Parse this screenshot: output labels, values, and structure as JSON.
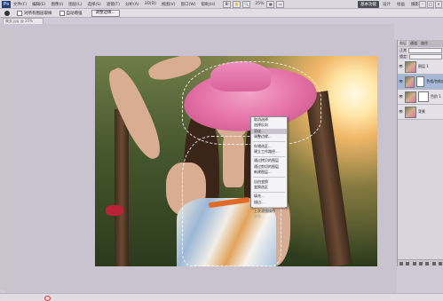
{
  "app": {
    "logo": "Ps",
    "menu": [
      "文件(F)",
      "编辑(E)",
      "图像(I)",
      "图层(L)",
      "选择(S)",
      "滤镜(T)",
      "分析(A)",
      "3D(D)",
      "视图(V)",
      "窗口(W)",
      "帮助(H)"
    ],
    "zoom": "25%",
    "workspace": [
      "基本功能",
      "设计",
      "绘画",
      "摄影"
    ],
    "active_workspace": "基本功能"
  },
  "options_bar": {
    "sample_all_layers": "对所有图层取样",
    "auto_enhance": "自动增强",
    "refine_edge_button": "调整边缘..."
  },
  "document": {
    "tab_title": "美女.jpg @ 25%"
  },
  "context_menu": {
    "items": [
      {
        "label": "取消选择",
        "state": "normal"
      },
      {
        "label": "选择反向",
        "state": "normal"
      },
      {
        "label": "羽化...",
        "state": "highlight"
      },
      {
        "label": "调整边缘...",
        "state": "normal"
      },
      {
        "sep": true
      },
      {
        "label": "存储选区...",
        "state": "normal"
      },
      {
        "label": "建立工作路径...",
        "state": "normal"
      },
      {
        "sep": true
      },
      {
        "label": "通过拷贝的图层",
        "state": "normal"
      },
      {
        "label": "通过剪切的图层",
        "state": "normal"
      },
      {
        "label": "新建图层...",
        "state": "normal"
      },
      {
        "sep": true
      },
      {
        "label": "自由变换",
        "state": "normal"
      },
      {
        "label": "变换选区",
        "state": "normal"
      },
      {
        "sep": true
      },
      {
        "label": "填充...",
        "state": "normal"
      },
      {
        "label": "描边...",
        "state": "normal"
      },
      {
        "sep": true
      },
      {
        "label": "上次滤镜操作",
        "state": "normal"
      },
      {
        "label": "渐隐...",
        "state": "disabled"
      }
    ]
  },
  "layers_panel": {
    "tabs": [
      "图层",
      "通道",
      "路径"
    ],
    "blend_mode": "正常",
    "lock_label": "锁定:",
    "layers": [
      {
        "name": "图层 1",
        "selected": false,
        "mask": false
      },
      {
        "name": "色相/饱和度 1",
        "selected": true,
        "mask": true
      },
      {
        "name": "色阶 1",
        "selected": false,
        "mask": true
      },
      {
        "name": "背景",
        "selected": false,
        "mask": false
      }
    ]
  }
}
